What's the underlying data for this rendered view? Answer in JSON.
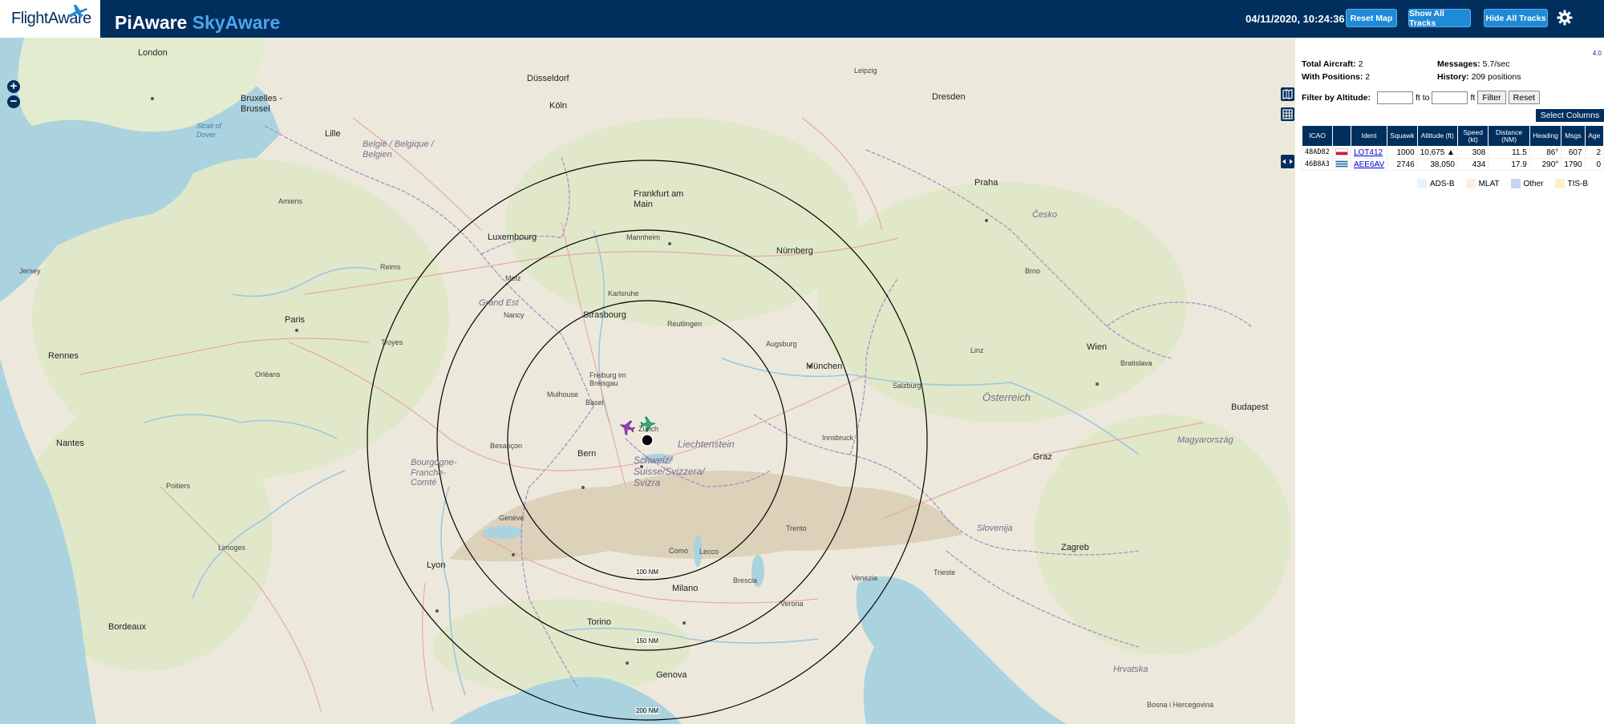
{
  "header": {
    "logo_text": "FlightAware",
    "title_part1": "PiAware",
    "title_part2": "SkyAware",
    "clock": "04/11/2020, 10:24:36",
    "reset_map": "Reset Map",
    "show_all_tracks": "Show All Tracks",
    "hide_all_tracks": "Hide All Tracks"
  },
  "icons": {
    "logo": "flightaware-plane-icon",
    "settings": "gear-icon",
    "zoom_in": "zoom-in-icon",
    "zoom_out": "zoom-out-icon",
    "map_layers": "map-layers-icon",
    "grid": "grid-icon",
    "collapse": "collapse-arrows-icon"
  },
  "map": {
    "zoom_in_label": "+",
    "zoom_out_label": "−",
    "range_rings": [
      "100 NM",
      "150 NM",
      "200 NM"
    ],
    "labels": {
      "london": "London",
      "paris": "Paris",
      "brussel": "Bruxelles - Brussel",
      "frankfurt": "Frankfurt am Main",
      "munchen": "München",
      "wien": "Wien",
      "praha": "Praha",
      "zurich": "Zürich",
      "bern": "Bern",
      "milano": "Milano",
      "torino": "Torino",
      "geneve": "Genève",
      "lyon": "Lyon",
      "strasbourg": "Strasbourg",
      "luxembourg": "Luxembourg",
      "venezia": "Venezia",
      "zagreb": "Zagreb",
      "ljubljana": "Slovenija",
      "bratislava": "Bratislava",
      "budapest": "Budapest",
      "nantes": "Nantes",
      "bordeaux": "Bordeaux",
      "rennes": "Rennes",
      "dresden": "Dresden",
      "nurnberg": "Nürnberg",
      "stuttgart": "Reutlingen",
      "osterreich": "Österreich",
      "schweiz": "Schweiz/ Suisse/Svizzera/ Svizra",
      "liechtenstein": "Liechtenstein",
      "belgique": "België / Belgique / Belgien",
      "cesko": "Česko",
      "genova": "Genova",
      "magyar": "Magyarország",
      "hrvatska": "Hrvatska",
      "lille": "Lille",
      "amiens": "Amiens",
      "leipzig": "Leipzig",
      "koln": "Köln",
      "dusseldorf": "Düsseldorf",
      "graz": "Graz",
      "verona": "Verona",
      "bosna": "Bosna i Hercegovina",
      "strait": "Strait of Dover",
      "jersey": "Jersey",
      "trieste": "Trieste",
      "brno": "Brno",
      "linz": "Linz",
      "basel": "Basel",
      "freiburg": "Freiburg im Breisgau",
      "mannheim": "Mannheim",
      "karlsruhe": "Karlsruhe",
      "augsburg": "Augsburg",
      "innsbruck": "Innsbruck",
      "salzburg": "Salzburg",
      "bolzano": "Trento",
      "brescia": "Brescia",
      "como": "Como",
      "lecco": "Lecco",
      "mulhouse": "Mulhouse",
      "besancon": "Besançon",
      "dijon": "Bourgogne-Franche-Comté",
      "grand_est": "Grand Est",
      "troyes": "Troyes",
      "reims": "Reims",
      "metz": "Metz",
      "nancy": "Nancy",
      "limoges": "Limoges",
      "poitiers": "Poitiers",
      "orleans": "Orléans"
    }
  },
  "sidebar": {
    "version": "4.0",
    "total_aircraft_label": "Total Aircraft:",
    "total_aircraft_value": "2",
    "with_positions_label": "With Positions:",
    "with_positions_value": "2",
    "messages_label": "Messages:",
    "messages_value": "5.7/sec",
    "history_label": "History:",
    "history_value": "209 positions",
    "filter_label": "Filter by Altitude:",
    "filter_to": "ft to",
    "filter_ft": "ft",
    "filter_button": "Filter",
    "reset_button": "Reset",
    "select_columns": "Select Columns",
    "table": {
      "headers": [
        "ICAO",
        "",
        "Ident",
        "Squawk",
        "Altitude (ft)",
        "Speed (kt)",
        "Distance (NM)",
        "Heading",
        "Msgs",
        "Age"
      ],
      "rows": [
        {
          "icao": "48AD82",
          "flag": "poland-flag",
          "ident": "LOT412",
          "squawk": "1000",
          "altitude": "10,675 ▲",
          "speed": "308",
          "distance": "11.5",
          "heading": "86°",
          "msgs": "607",
          "age": "2"
        },
        {
          "icao": "46B8A3",
          "flag": "greece-flag",
          "ident": "AEE6AV",
          "squawk": "2746",
          "altitude": "38,050",
          "speed": "434",
          "distance": "17.9",
          "heading": "290°",
          "msgs": "1790",
          "age": "0"
        }
      ]
    },
    "legend": [
      {
        "label": "ADS-B",
        "color": "#e9f4fb"
      },
      {
        "label": "MLAT",
        "color": "#fdeee3"
      },
      {
        "label": "Other",
        "color": "#c9d4f4"
      },
      {
        "label": "TIS-B",
        "color": "#fcf0c8"
      }
    ]
  }
}
